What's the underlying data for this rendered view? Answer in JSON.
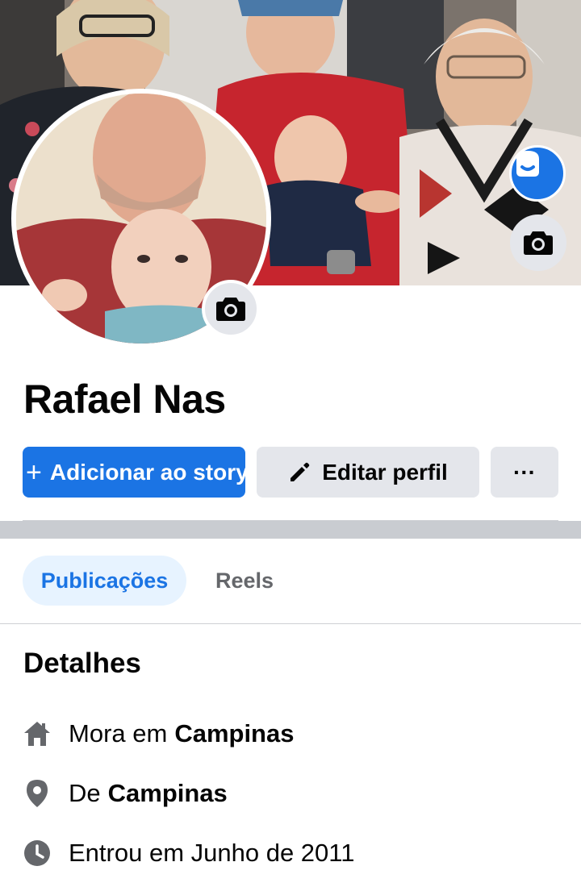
{
  "profile": {
    "name": "Rafael Nas"
  },
  "actions": {
    "add_story": "Adicionar ao story",
    "edit_profile": "Editar perfil",
    "more": "···"
  },
  "tabs": [
    {
      "label": "Publicações",
      "active": true
    },
    {
      "label": "Reels",
      "active": false
    }
  ],
  "details": {
    "title": "Detalhes",
    "lives_prefix": "Mora em",
    "lives_city": "Campinas",
    "from_prefix": "De",
    "from_city": "Campinas",
    "joined": "Entrou em Junho de 2011"
  },
  "icons": {
    "cover_camera": "camera-icon",
    "avatar_sticker": "avatar-sticker-icon",
    "profile_camera": "camera-icon",
    "edit": "pencil-icon",
    "home": "home-icon",
    "location": "location-pin-icon",
    "clock": "clock-icon"
  },
  "colors": {
    "primary": "#1b74e4",
    "button_gray": "#e4e6eb",
    "tab_active_bg": "#e7f3ff",
    "icon_gray": "#65676b",
    "separator": "#c9ccd1"
  }
}
